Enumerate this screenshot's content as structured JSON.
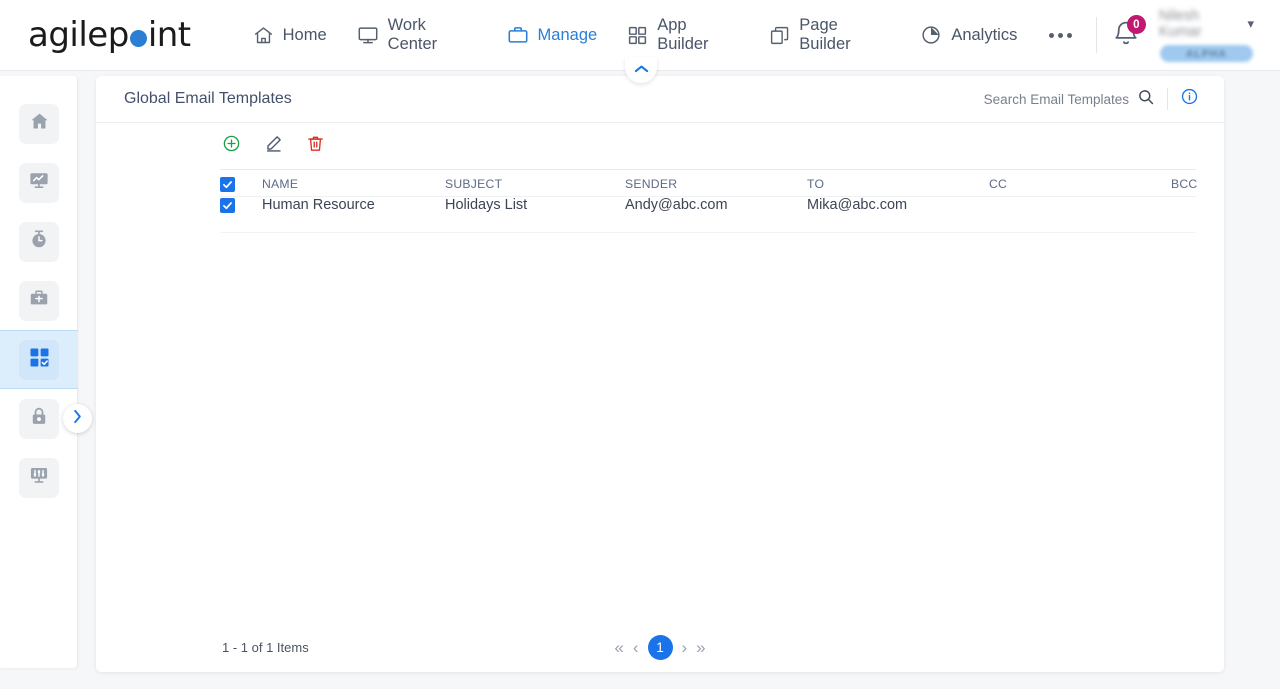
{
  "brand": {
    "name_part1": "agilep",
    "name_dot": "o",
    "name_part2": "int",
    "accent_color": "#2a7fd4"
  },
  "topnav": {
    "items": [
      {
        "label": "Home",
        "icon": "home-icon",
        "active": false
      },
      {
        "label": "Work Center",
        "icon": "monitor-icon",
        "active": false
      },
      {
        "label": "Manage",
        "icon": "briefcase-icon",
        "active": true
      },
      {
        "label": "App Builder",
        "icon": "grid-icon",
        "active": false
      },
      {
        "label": "Page Builder",
        "icon": "pages-icon",
        "active": false
      },
      {
        "label": "Analytics",
        "icon": "pie-chart-icon",
        "active": false
      }
    ],
    "more_label": "",
    "notification_count": "0",
    "user_name": "Nilesh Kumar",
    "user_badge": "ALPHA"
  },
  "sidebar": {
    "items": [
      {
        "name": "home",
        "icon": "home-icon",
        "active": false
      },
      {
        "name": "reports",
        "icon": "chart-monitor-icon",
        "active": false
      },
      {
        "name": "timer",
        "icon": "stopwatch-icon",
        "active": false
      },
      {
        "name": "portfolio",
        "icon": "briefcase-icon",
        "active": false
      },
      {
        "name": "apps",
        "icon": "app-grid-check-icon",
        "active": true
      },
      {
        "name": "security",
        "icon": "lock-icon",
        "active": false
      },
      {
        "name": "settings",
        "icon": "sliders-monitor-icon",
        "active": false
      }
    ]
  },
  "panel": {
    "title": "Global Email Templates",
    "search": {
      "placeholder": "Search Email Templates",
      "value": ""
    },
    "toolbar": [
      {
        "name": "add",
        "icon": "plus-circle-icon",
        "color": "#1e9e4a"
      },
      {
        "name": "edit",
        "icon": "pencil-icon",
        "color": "#4a5568"
      },
      {
        "name": "delete",
        "icon": "trash-icon",
        "color": "#d93025"
      }
    ],
    "table": {
      "select_all_checked": true,
      "columns": [
        "NAME",
        "SUBJECT",
        "SENDER",
        "TO",
        "CC",
        "BCC"
      ],
      "rows": [
        {
          "checked": true,
          "NAME": "Human Resource",
          "SUBJECT": "Holidays List",
          "SENDER": "Andy@abc.com",
          "TO": "Mika@abc.com",
          "CC": "",
          "BCC": ""
        }
      ]
    },
    "footer": {
      "items_count": "1 - 1 of 1 Items",
      "pagination": {
        "first": "«",
        "prev": "‹",
        "current_page": "1",
        "next": "›",
        "last": "»"
      }
    }
  }
}
